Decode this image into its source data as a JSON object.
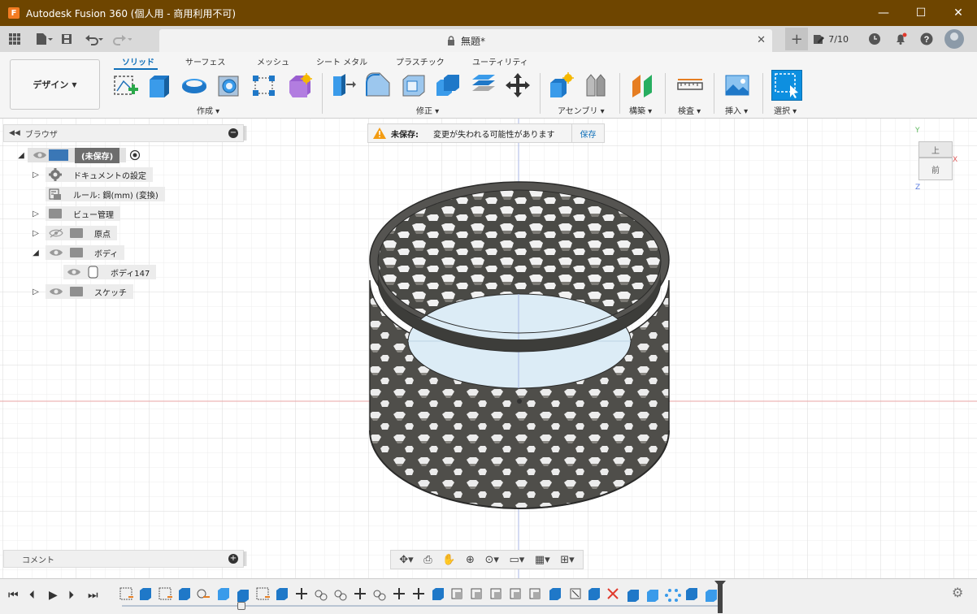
{
  "titlebar": {
    "title": "Autodesk Fusion 360 (個人用 - 商用利用不可)",
    "logo_letter": "F",
    "minimize": "—",
    "maximize": "☐",
    "close": "✕"
  },
  "quickaccess": {
    "doc_tab_title": "無題*",
    "doc_tab_close": "✕",
    "job_status": "7/10"
  },
  "ribbon": {
    "workspace": "デザイン",
    "tabs": [
      "ソリッド",
      "サーフェス",
      "メッシュ",
      "シート メタル",
      "プラスチック",
      "ユーティリティ"
    ],
    "groups": [
      "作成",
      "修正",
      "アセンブリ",
      "構築",
      "検査",
      "挿入",
      "選択"
    ]
  },
  "browser": {
    "title": "ブラウザ",
    "root": "(未保存)",
    "items": {
      "doc_settings": "ドキュメントの設定",
      "rule": "ルール: 鋼(mm) (変換)",
      "view_manager": "ビュー管理",
      "origin": "原点",
      "bodies": "ボディ",
      "body147": "ボディ147",
      "sketches": "スケッチ"
    }
  },
  "notice": {
    "label": "未保存:",
    "message": "変更が失われる可能性があります",
    "save": "保存"
  },
  "viewcube": {
    "top": "上",
    "front": "前",
    "axis_x": "X",
    "axis_y": "Y",
    "axis_z": "Z"
  },
  "comments": {
    "title": "コメント"
  },
  "colors": {
    "titlebar": "#6e4500",
    "accent": "#0f6fb9",
    "model": "#4a4a46"
  }
}
